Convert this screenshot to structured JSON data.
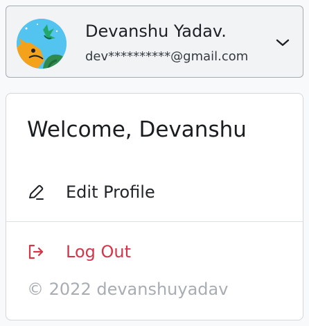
{
  "account": {
    "name": "Devanshu Yadav.",
    "email": "dev**********@gmail.com",
    "avatar_icon": "illustrated-avatar",
    "toggle_icon": "chevron-down-icon"
  },
  "menu": {
    "welcome": "Welcome, Devanshu",
    "items": [
      {
        "label": "Edit Profile",
        "icon": "pencil-icon",
        "color": "#212529"
      },
      {
        "label": "Log Out",
        "icon": "logout-icon",
        "color": "#d63447"
      }
    ],
    "copyright": "© 2022 devanshuyadav"
  }
}
